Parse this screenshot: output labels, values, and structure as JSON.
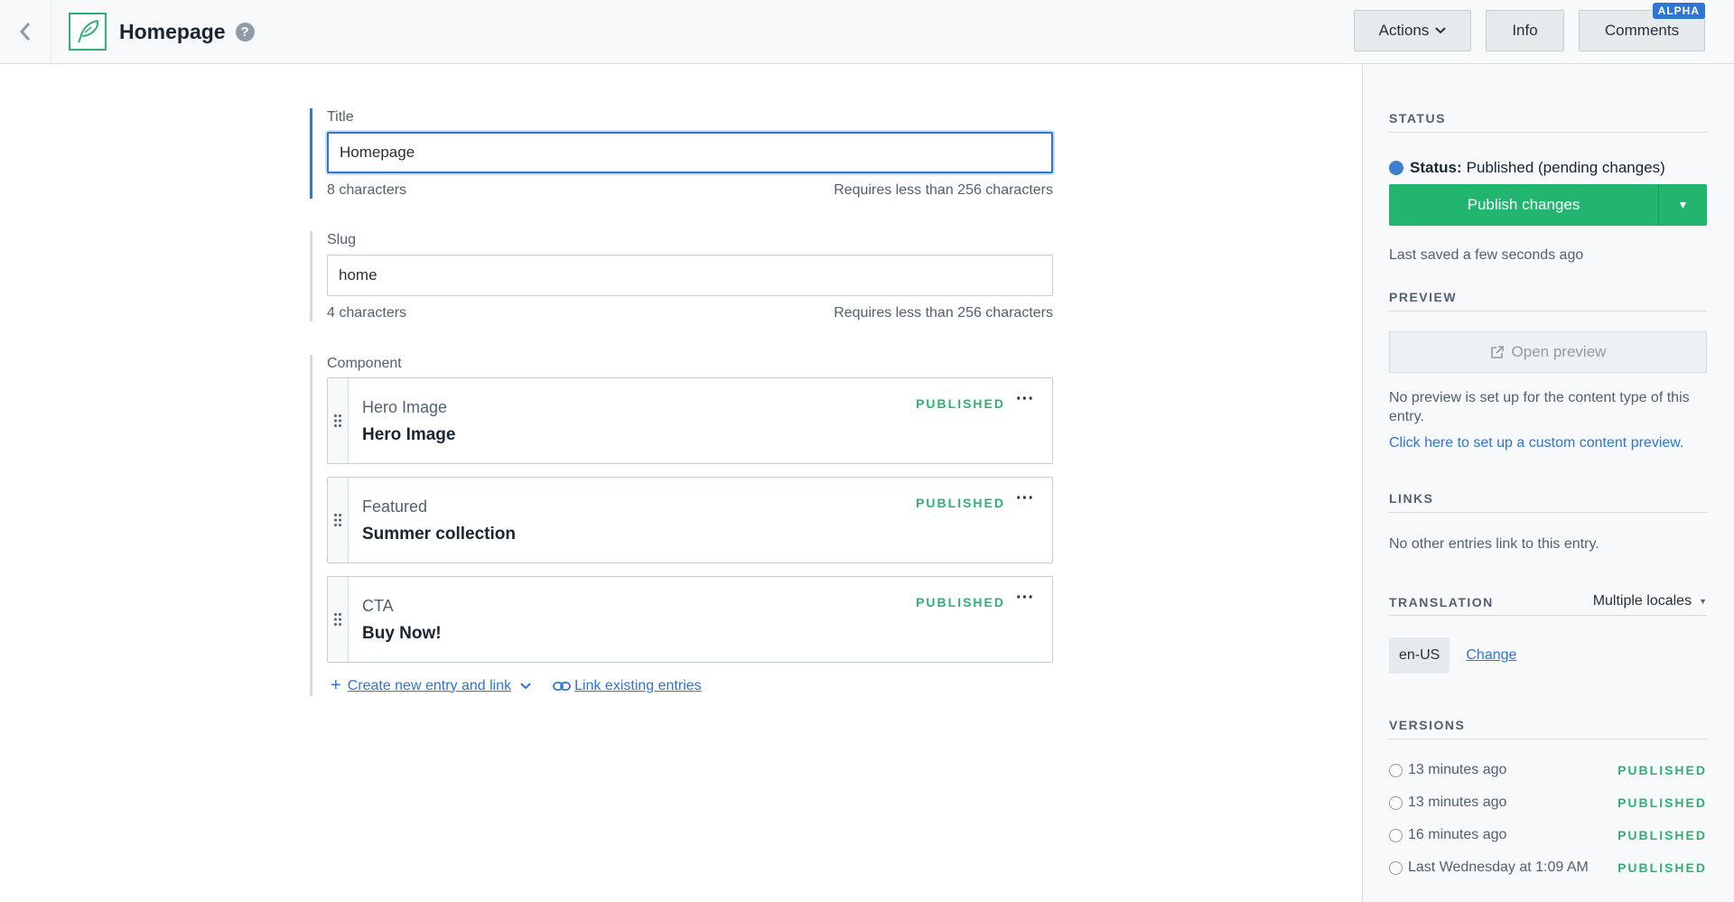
{
  "header": {
    "title": "Homepage",
    "help_glyph": "?",
    "actions_label": "Actions",
    "info_label": "Info",
    "comments_label": "Comments",
    "alpha_badge": "ALPHA",
    "icons": [
      "back-icon",
      "entry-feather-icon",
      "help-icon",
      "chevron-down-icon"
    ]
  },
  "fields": {
    "title": {
      "label": "Title",
      "value": "Homepage",
      "count": "8 characters",
      "limit": "Requires less than 256 characters"
    },
    "slug": {
      "label": "Slug",
      "value": "home",
      "count": "4 characters",
      "limit": "Requires less than 256 characters"
    },
    "component": {
      "label": "Component",
      "entries": [
        {
          "type": "Hero Image",
          "name": "Hero Image",
          "status": "PUBLISHED"
        },
        {
          "type": "Featured",
          "name": "Summer collection",
          "status": "PUBLISHED"
        },
        {
          "type": "CTA",
          "name": "Buy Now!",
          "status": "PUBLISHED"
        }
      ],
      "more_glyph": "···",
      "create_link": "Create new entry and link",
      "link_existing": "Link existing entries"
    }
  },
  "sidebar": {
    "status": {
      "heading": "STATUS",
      "status_label": "Status:",
      "status_value": "Published (pending changes)",
      "publish_label": "Publish changes",
      "last_saved": "Last saved a few seconds ago"
    },
    "preview": {
      "heading": "PREVIEW",
      "button": "Open preview",
      "note": "No preview is set up for the content type of this entry.",
      "setup_link": "Click here to set up a custom content preview."
    },
    "links": {
      "heading": "LINKS",
      "note": "No other entries link to this entry."
    },
    "translation": {
      "heading": "TRANSLATION",
      "select": "Multiple locales",
      "locale": "en-US",
      "change": "Change"
    },
    "versions": {
      "heading": "VERSIONS",
      "items": [
        {
          "time": "13 minutes ago",
          "status": "PUBLISHED"
        },
        {
          "time": "13 minutes ago",
          "status": "PUBLISHED"
        },
        {
          "time": "16 minutes ago",
          "status": "PUBLISHED"
        },
        {
          "time": "Last Wednesday at 1:09 AM",
          "status": "PUBLISHED"
        }
      ]
    }
  },
  "colors": {
    "accent_blue": "#2e75d4",
    "publish_green": "#21b56f",
    "status_green": "#2fb174",
    "status_dot": "#3c80cf"
  }
}
